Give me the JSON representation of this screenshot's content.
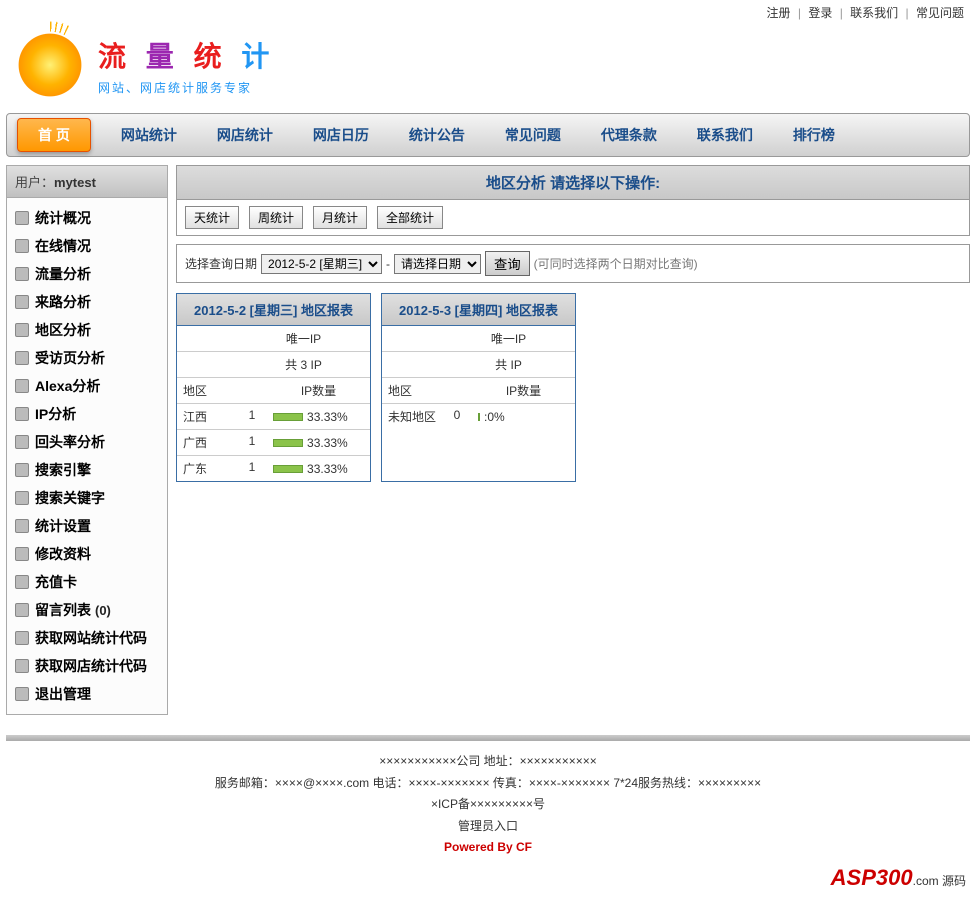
{
  "top_links": {
    "register": "注册",
    "login": "登录",
    "contact": "联系我们",
    "faq": "常见问题"
  },
  "logo": {
    "title_chars": [
      "流",
      "量",
      "统",
      "计"
    ],
    "subtitle": "网站、网店统计服务专家"
  },
  "nav": [
    {
      "label": "首 页",
      "active": true
    },
    {
      "label": "网站统计"
    },
    {
      "label": "网店统计"
    },
    {
      "label": "网店日历"
    },
    {
      "label": "统计公告"
    },
    {
      "label": "常见问题"
    },
    {
      "label": "代理条款"
    },
    {
      "label": "联系我们"
    },
    {
      "label": "排行榜"
    }
  ],
  "user_label": "用户：",
  "user_name": "mytest",
  "sidebar": [
    {
      "label": "统计概况"
    },
    {
      "label": "在线情况"
    },
    {
      "label": "流量分析"
    },
    {
      "label": "来路分析"
    },
    {
      "label": "地区分析"
    },
    {
      "label": "受访页分析"
    },
    {
      "label": "Alexa分析"
    },
    {
      "label": "IP分析"
    },
    {
      "label": "回头率分析"
    },
    {
      "label": "搜索引擎"
    },
    {
      "label": "搜索关键字"
    },
    {
      "label": "统计设置"
    },
    {
      "label": "修改资料"
    },
    {
      "label": "充值卡"
    },
    {
      "label": "留言列表",
      "count": "(0)"
    },
    {
      "label": "获取网站统计代码"
    },
    {
      "label": "获取网店统计代码"
    },
    {
      "label": "退出管理"
    }
  ],
  "panel_title": "地区分析  请选择以下操作:",
  "subtabs": [
    "天统计",
    "周统计",
    "月统计",
    "全部统计"
  ],
  "query": {
    "label": "选择查询日期",
    "date1_selected": "2012-5-2 [星期三]",
    "sep": "-",
    "date2_selected": "请选择日期",
    "btn": "查询",
    "hint": "(可同时选择两个日期对比查询)"
  },
  "reports": [
    {
      "title": "2012-5-2 [星期三] 地区报表",
      "uniq_label": "唯一IP",
      "total_label": "共 3 IP",
      "col_area": "地区",
      "col_ip": "IP数量",
      "rows": [
        {
          "area": "江西",
          "count": "1",
          "pct": "33.33%",
          "bar": 33
        },
        {
          "area": "广西",
          "count": "1",
          "pct": "33.33%",
          "bar": 33
        },
        {
          "area": "广东",
          "count": "1",
          "pct": "33.33%",
          "bar": 33
        }
      ]
    },
    {
      "title": "2012-5-3 [星期四] 地区报表",
      "uniq_label": "唯一IP",
      "total_label": "共  IP",
      "col_area": "地区",
      "col_ip": "IP数量",
      "rows": [
        {
          "area": "未知地区",
          "count": "0",
          "pct": ":0%",
          "bar": 0
        }
      ]
    }
  ],
  "footer": {
    "l1": "×××××××××××公司  地址：×××××××××××",
    "l2": "服务邮箱：××××@××××.com 电话：××××-××××××× 传真：××××-××××××× 7*24服务热线：×××××××××",
    "l3": "×ICP备×××××××××号",
    "l4": "管理员入口",
    "powered": "Powered By CF"
  },
  "corner": {
    "brand": "ASP300",
    "suffix": ".com",
    "tag": "源码"
  }
}
